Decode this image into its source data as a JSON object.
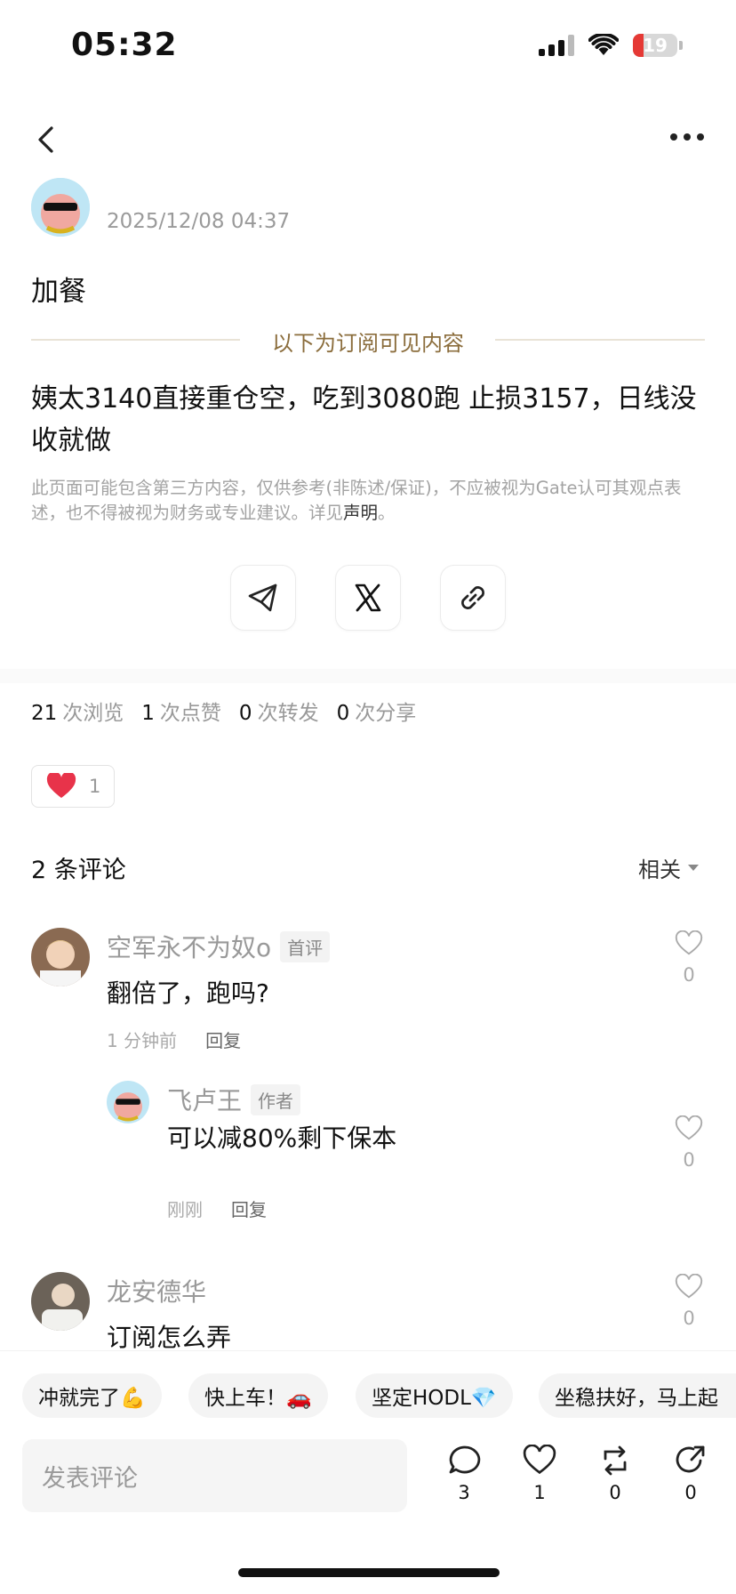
{
  "status_bar": {
    "time": "05:32",
    "battery": "19"
  },
  "post": {
    "author_partial": "飞卢王",
    "timestamp": "2025/12/08 04:37",
    "title": "加餐",
    "subscriber_label": "以下为订阅可见内容",
    "body": "姨太3140直接重仓空，吃到3080跑 止损3157，日线没收就做",
    "disclaimer": "此页面可能包含第三方内容，仅供参考(非陈述/保证)，不应被视为Gate认可其观点表述，也不得被视为财务或专业建议。详见",
    "disclaimer_link": "声明",
    "disclaimer_end": "。"
  },
  "share": {
    "icons": [
      "telegram-icon",
      "x-icon",
      "link-icon"
    ]
  },
  "stats": {
    "views": "21",
    "views_label": "次浏览",
    "likes": "1",
    "likes_label": "次点赞",
    "reposts": "0",
    "reposts_label": "次转发",
    "shares": "0",
    "shares_label": "次分享"
  },
  "reaction": {
    "count": "1"
  },
  "comments": {
    "title": "2 条评论",
    "sort": "相关",
    "items": [
      {
        "name": "空军永不为奴o",
        "tag": "首评",
        "text": "翻倍了，跑吗?",
        "time": "1 分钟前",
        "reply": "回复",
        "likes": "0"
      },
      {
        "name": "飞卢王",
        "tag": "作者",
        "text": "可以减80%剩下保本",
        "time": "刚刚",
        "reply": "回复",
        "likes": "0"
      },
      {
        "name": "龙安德华",
        "text": "订阅怎么弄",
        "likes": "0"
      }
    ]
  },
  "quick_replies": [
    "冲就完了💪",
    "快上车！🚗",
    "坚定HODL💎",
    "坐稳扶好，马上起"
  ],
  "bottom_bar": {
    "placeholder": "发表评论",
    "comments": "3",
    "likes": "1",
    "reposts": "0",
    "shares": "0"
  },
  "colors": {
    "accent_gold": "#8b6d3c",
    "heart_red": "#e8334a",
    "battery_red": "#e53935"
  }
}
